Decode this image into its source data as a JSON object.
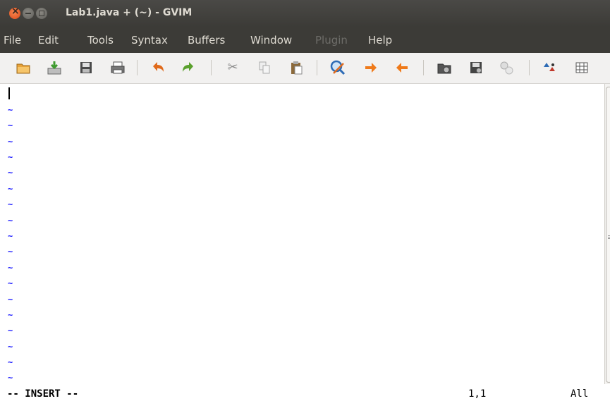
{
  "window": {
    "title": "Lab1.java + (~) - GVIM",
    "controls": [
      "close",
      "minimize",
      "maximize"
    ]
  },
  "menubar": {
    "items": [
      {
        "label": "File",
        "enabled": true
      },
      {
        "label": "Edit",
        "enabled": true
      },
      {
        "label": "Tools",
        "enabled": true
      },
      {
        "label": "Syntax",
        "enabled": true
      },
      {
        "label": "Buffers",
        "enabled": true
      },
      {
        "label": "Window",
        "enabled": true
      },
      {
        "label": "Plugin",
        "enabled": false
      },
      {
        "label": "Help",
        "enabled": true
      }
    ]
  },
  "toolbar": {
    "icons": [
      "open-file-icon",
      "save-icon",
      "save-all-icon",
      "print-icon",
      "undo-icon",
      "redo-icon",
      "cut-icon",
      "copy-icon",
      "paste-icon",
      "find-replace-icon",
      "find-next-icon",
      "find-previous-icon",
      "load-session-icon",
      "save-session-icon",
      "run-script-icon",
      "make-icon",
      "table-icon"
    ]
  },
  "editor": {
    "empty_line_marker": "~",
    "colors": {
      "tilde": "#2020ff",
      "background": "#ffffff"
    }
  },
  "status": {
    "mode": "-- INSERT --",
    "position": "1,1",
    "scroll": "All"
  }
}
